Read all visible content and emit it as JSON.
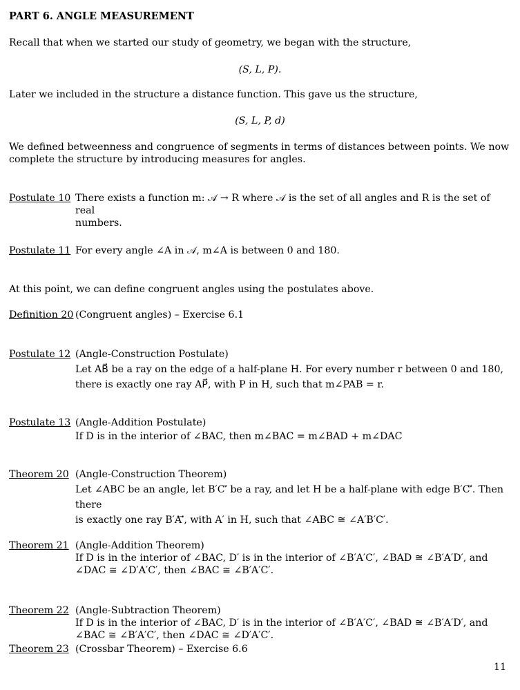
{
  "heading": "PART 6. ANGLE MEASUREMENT",
  "intro": {
    "p1": "Recall that when we started our study of geometry, we began with the structure,",
    "eq1": "(S, L, P).",
    "p2": "Later we included in the structure a distance function. This gave us the structure,",
    "eq2": "(S, L, P, d)",
    "p3_line1": "We defined betweenness and congruence of segments in terms of distances between points. We now",
    "p3_line2": "complete the structure by introducing measures for angles."
  },
  "items": [
    {
      "label": "Postulate 10",
      "lines": [
        "There exists a function m: 𝒜 → R where 𝒜 is the set of all angles and R is the set of real",
        "numbers."
      ]
    },
    {
      "label": "Postulate 11",
      "lines": [
        "For every angle ∠A in 𝒜, m∠A is between 0 and 180."
      ]
    },
    {
      "label": "Definition 20",
      "lines": [
        "(Congruent angles) – Exercise 6.1"
      ]
    },
    {
      "label": "Postulate 12",
      "lines": [
        "(Angle-Construction Postulate)",
        "Let AB⃗ be a ray on the edge of a half-plane H. For every number r between 0 and 180,",
        "there is exactly one ray AP⃗, with P in H, such that m∠PAB = r."
      ]
    },
    {
      "label": "Postulate 13",
      "lines": [
        "(Angle-Addition Postulate)",
        "If D is in the interior of ∠BAC, then m∠BAC = m∠BAD + m∠DAC"
      ]
    },
    {
      "label": "Theorem 20",
      "lines": [
        "(Angle-Construction Theorem)",
        "Let ∠ABC be an angle, let B′C′⃗ be a ray, and let H be a half-plane with edge B′C′⃡. Then there",
        "is exactly one ray B′A′⃗, with A′ in H, such that ∠ABC ≅ ∠A′B′C′."
      ]
    },
    {
      "label": "Theorem 21",
      "lines": [
        "(Angle-Addition Theorem)",
        "If D is in the interior of ∠BAC, D′ is in the interior of ∠B′A′C′, ∠BAD ≅ ∠B′A′D′, and",
        "∠DAC ≅ ∠D′A′C′, then ∠BAC ≅ ∠B′A′C′."
      ]
    },
    {
      "label": "Theorem 22",
      "lines": [
        "(Angle-Subtraction Theorem)",
        "If D is in the interior of ∠BAC, D′ is in the interior of ∠B′A′C′, ∠BAD ≅ ∠B′A′D′, and",
        "∠BAC ≅ ∠B′A′C′, then ∠DAC ≅ ∠D′A′C′."
      ]
    },
    {
      "label": "Theorem 23",
      "lines": [
        "(Crossbar Theorem) – Exercise 6.6"
      ]
    }
  ],
  "mid_text": "At this point, we can define congruent angles using the postulates above.",
  "page_number": "11"
}
